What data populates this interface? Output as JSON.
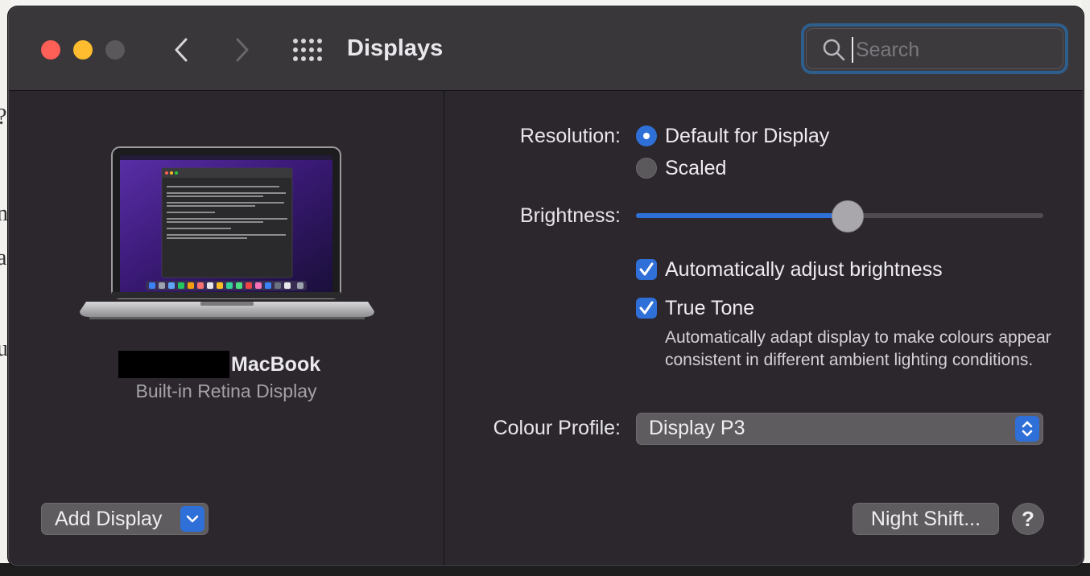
{
  "window": {
    "title": "Displays",
    "search": {
      "placeholder": "Search",
      "value": ""
    }
  },
  "toolbar": {
    "icons": [
      "back-chevron",
      "forward-chevron",
      "grid"
    ]
  },
  "left_panel": {
    "display_name": "MacBook",
    "display_subtitle": "Built-in Retina Display",
    "add_display_label": "Add Display"
  },
  "settings": {
    "resolution_label": "Resolution:",
    "resolution_options": [
      {
        "label": "Default for Display",
        "selected": true
      },
      {
        "label": "Scaled",
        "selected": false
      }
    ],
    "brightness_label": "Brightness:",
    "brightness_value": 0.52,
    "auto_brightness": {
      "label": "Automatically adjust brightness",
      "checked": true
    },
    "true_tone": {
      "label": "True Tone",
      "checked": true,
      "description": "Automatically adapt display to make colours appear consistent in different ambient lighting conditions."
    },
    "colour_profile_label": "Colour Profile:",
    "colour_profile_value": "Display P3"
  },
  "footer": {
    "night_shift_label": "Night Shift...",
    "help_label": "?"
  },
  "colors": {
    "accent": "#2f6fd8",
    "window_bg": "#2b272d",
    "titlebar_bg": "#3a373b"
  }
}
